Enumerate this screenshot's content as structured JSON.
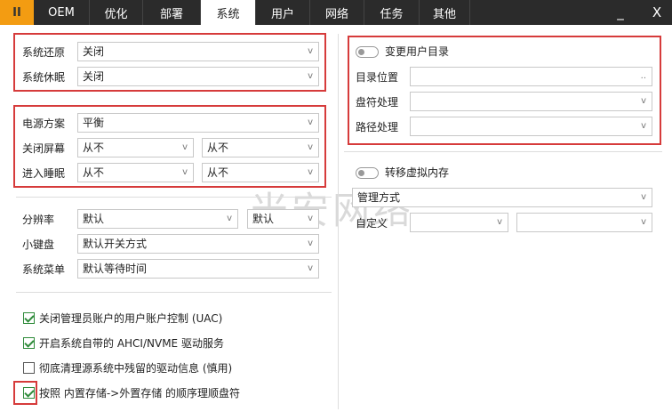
{
  "tabs": [
    {
      "label": "II"
    },
    {
      "label": "OEM"
    },
    {
      "label": "优化"
    },
    {
      "label": "部署"
    },
    {
      "label": "系统"
    },
    {
      "label": "用户"
    },
    {
      "label": "网络"
    },
    {
      "label": "任务"
    },
    {
      "label": "其他"
    }
  ],
  "window": {
    "minimize": "_",
    "close": "X"
  },
  "recovery": {
    "restore_label": "系统还原",
    "restore_value": "关闭",
    "hibernate_label": "系统休眠",
    "hibernate_value": "关闭"
  },
  "power": {
    "plan_label": "电源方案",
    "plan_value": "平衡",
    "screen_label": "关闭屏幕",
    "screen_ac": "从不",
    "screen_dc": "从不",
    "sleep_label": "进入睡眠",
    "sleep_ac": "从不",
    "sleep_dc": "从不"
  },
  "display": {
    "resolution_label": "分辨率",
    "resolution_value": "默认",
    "refresh_value": "默认",
    "keypad_label": "小键盘",
    "keypad_value": "默认开关方式",
    "menu_label": "系统菜单",
    "menu_value": "默认等待时间"
  },
  "options": [
    {
      "label": "关闭管理员账户的用户账户控制 (UAC)",
      "checked": true
    },
    {
      "label": "开启系统自带的 AHCI/NVME 驱动服务",
      "checked": true
    },
    {
      "label": "彻底清理源系统中残留的驱动信息 (慎用)",
      "checked": false
    },
    {
      "label": "按照 内置存储->外置存储 的顺序理顺盘符",
      "checked": true
    }
  ],
  "userdir": {
    "toggle_label": "变更用户目录",
    "location_label": "目录位置",
    "location_browse": "..",
    "drive_label": "盘符处理",
    "path_label": "路径处理"
  },
  "vmem": {
    "toggle_label": "转移虚拟内存",
    "mode_label": "管理方式",
    "custom_label": "自定义"
  },
  "watermark": "米安网络",
  "chevron": "v",
  "colors": {
    "accent_tab": "#f39c12",
    "topbar": "#2b2b2b",
    "highlight": "#d63b3b",
    "check": "#2e8b3a"
  }
}
